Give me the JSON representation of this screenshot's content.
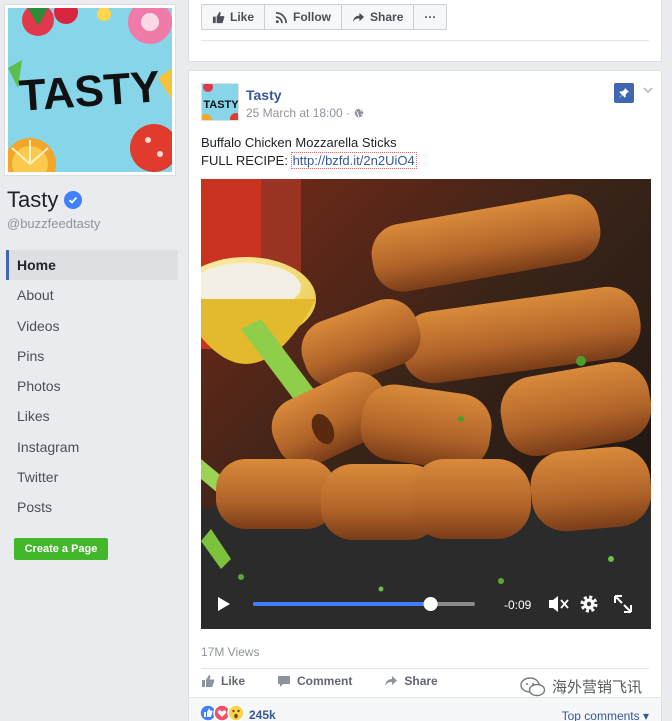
{
  "page": {
    "name": "Tasty",
    "handle": "@buzzfeedtasty",
    "logo_text": "TASTY"
  },
  "nav": {
    "items": [
      {
        "label": "Home",
        "active": true
      },
      {
        "label": "About"
      },
      {
        "label": "Videos"
      },
      {
        "label": "Pins"
      },
      {
        "label": "Photos"
      },
      {
        "label": "Likes"
      },
      {
        "label": "Instagram"
      },
      {
        "label": "Twitter"
      },
      {
        "label": "Posts"
      }
    ],
    "create_page_label": "Create a Page"
  },
  "top_actions": {
    "like": "Like",
    "follow": "Follow",
    "share": "Share",
    "more": "···"
  },
  "post": {
    "author": "Tasty",
    "timestamp": "25 March at 18:00 ·",
    "title_line": "Buffalo Chicken Mozzarella Sticks",
    "recipe_prefix": "FULL RECIPE:",
    "recipe_link": "http://bzfd.it/2n2UiO4",
    "video": {
      "time_remaining": "-0:09",
      "progress": 0.8
    },
    "views": "17M Views",
    "actions": {
      "like": "Like",
      "comment": "Comment",
      "share": "Share"
    },
    "reactions_count": "245k",
    "top_comments": "Top comments ▾"
  },
  "watermark": "海外营销飞讯",
  "colors": {
    "brand_blue": "#4267b2",
    "link_blue": "#365899",
    "green": "#42b72a",
    "background": "#e9ebee"
  }
}
